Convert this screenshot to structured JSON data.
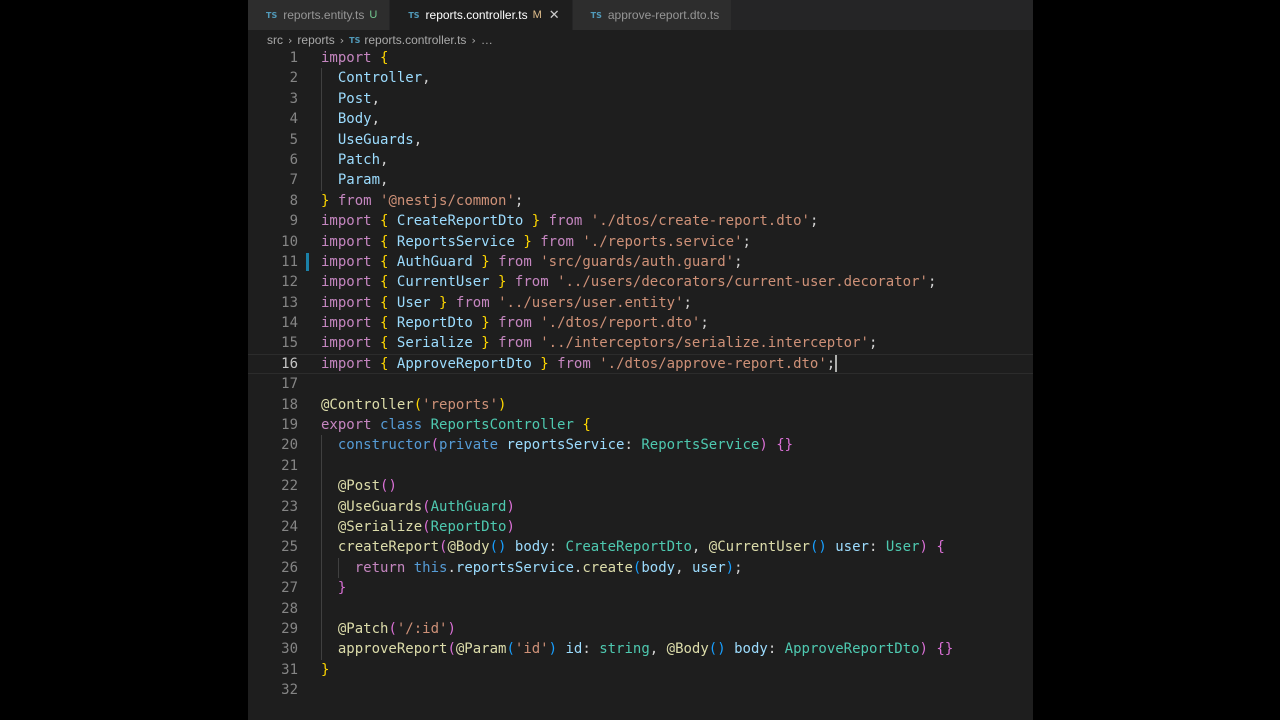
{
  "tabs": [
    {
      "icon": "TS",
      "label": "reports.entity.ts",
      "status": "U",
      "active": false
    },
    {
      "icon": "TS",
      "label": "reports.controller.ts",
      "status": "M",
      "active": true
    },
    {
      "icon": "TS",
      "label": "approve-report.dto.ts",
      "status": "",
      "active": false
    }
  ],
  "breadcrumb": {
    "folder1": "src",
    "folder2": "reports",
    "file": "reports.controller.ts",
    "more": "…"
  },
  "cursor_line": 16,
  "code_lines": [
    [
      [
        "k",
        "import"
      ],
      [
        "p",
        " "
      ],
      [
        "b1",
        "{"
      ]
    ],
    [
      [
        "p",
        "  "
      ],
      [
        "v",
        "Controller"
      ],
      [
        "p",
        ","
      ]
    ],
    [
      [
        "p",
        "  "
      ],
      [
        "v",
        "Post"
      ],
      [
        "p",
        ","
      ]
    ],
    [
      [
        "p",
        "  "
      ],
      [
        "v",
        "Body"
      ],
      [
        "p",
        ","
      ]
    ],
    [
      [
        "p",
        "  "
      ],
      [
        "v",
        "UseGuards"
      ],
      [
        "p",
        ","
      ]
    ],
    [
      [
        "p",
        "  "
      ],
      [
        "v",
        "Patch"
      ],
      [
        "p",
        ","
      ]
    ],
    [
      [
        "p",
        "  "
      ],
      [
        "v",
        "Param"
      ],
      [
        "p",
        ","
      ]
    ],
    [
      [
        "b1",
        "}"
      ],
      [
        "p",
        " "
      ],
      [
        "k",
        "from"
      ],
      [
        "p",
        " "
      ],
      [
        "s",
        "'@nestjs/common'"
      ],
      [
        "p",
        ";"
      ]
    ],
    [
      [
        "k",
        "import"
      ],
      [
        "p",
        " "
      ],
      [
        "b1",
        "{"
      ],
      [
        "p",
        " "
      ],
      [
        "v",
        "CreateReportDto"
      ],
      [
        "p",
        " "
      ],
      [
        "b1",
        "}"
      ],
      [
        "p",
        " "
      ],
      [
        "k",
        "from"
      ],
      [
        "p",
        " "
      ],
      [
        "s",
        "'./dtos/create-report.dto'"
      ],
      [
        "p",
        ";"
      ]
    ],
    [
      [
        "k",
        "import"
      ],
      [
        "p",
        " "
      ],
      [
        "b1",
        "{"
      ],
      [
        "p",
        " "
      ],
      [
        "v",
        "ReportsService"
      ],
      [
        "p",
        " "
      ],
      [
        "b1",
        "}"
      ],
      [
        "p",
        " "
      ],
      [
        "k",
        "from"
      ],
      [
        "p",
        " "
      ],
      [
        "s",
        "'./reports.service'"
      ],
      [
        "p",
        ";"
      ]
    ],
    [
      [
        "k",
        "import"
      ],
      [
        "p",
        " "
      ],
      [
        "b1",
        "{"
      ],
      [
        "p",
        " "
      ],
      [
        "v",
        "AuthGuard"
      ],
      [
        "p",
        " "
      ],
      [
        "b1",
        "}"
      ],
      [
        "p",
        " "
      ],
      [
        "k",
        "from"
      ],
      [
        "p",
        " "
      ],
      [
        "s",
        "'src/guards/auth.guard'"
      ],
      [
        "p",
        ";"
      ]
    ],
    [
      [
        "k",
        "import"
      ],
      [
        "p",
        " "
      ],
      [
        "b1",
        "{"
      ],
      [
        "p",
        " "
      ],
      [
        "v",
        "CurrentUser"
      ],
      [
        "p",
        " "
      ],
      [
        "b1",
        "}"
      ],
      [
        "p",
        " "
      ],
      [
        "k",
        "from"
      ],
      [
        "p",
        " "
      ],
      [
        "s",
        "'../users/decorators/current-user.decorator'"
      ],
      [
        "p",
        ";"
      ]
    ],
    [
      [
        "k",
        "import"
      ],
      [
        "p",
        " "
      ],
      [
        "b1",
        "{"
      ],
      [
        "p",
        " "
      ],
      [
        "v",
        "User"
      ],
      [
        "p",
        " "
      ],
      [
        "b1",
        "}"
      ],
      [
        "p",
        " "
      ],
      [
        "k",
        "from"
      ],
      [
        "p",
        " "
      ],
      [
        "s",
        "'../users/user.entity'"
      ],
      [
        "p",
        ";"
      ]
    ],
    [
      [
        "k",
        "import"
      ],
      [
        "p",
        " "
      ],
      [
        "b1",
        "{"
      ],
      [
        "p",
        " "
      ],
      [
        "v",
        "ReportDto"
      ],
      [
        "p",
        " "
      ],
      [
        "b1",
        "}"
      ],
      [
        "p",
        " "
      ],
      [
        "k",
        "from"
      ],
      [
        "p",
        " "
      ],
      [
        "s",
        "'./dtos/report.dto'"
      ],
      [
        "p",
        ";"
      ]
    ],
    [
      [
        "k",
        "import"
      ],
      [
        "p",
        " "
      ],
      [
        "b1",
        "{"
      ],
      [
        "p",
        " "
      ],
      [
        "v",
        "Serialize"
      ],
      [
        "p",
        " "
      ],
      [
        "b1",
        "}"
      ],
      [
        "p",
        " "
      ],
      [
        "k",
        "from"
      ],
      [
        "p",
        " "
      ],
      [
        "s",
        "'../interceptors/serialize.interceptor'"
      ],
      [
        "p",
        ";"
      ]
    ],
    [
      [
        "k",
        "import"
      ],
      [
        "p",
        " "
      ],
      [
        "b1",
        "{"
      ],
      [
        "p",
        " "
      ],
      [
        "v",
        "ApproveReportDto"
      ],
      [
        "p",
        " "
      ],
      [
        "b1",
        "}"
      ],
      [
        "p",
        " "
      ],
      [
        "k",
        "from"
      ],
      [
        "p",
        " "
      ],
      [
        "s",
        "'./dtos/approve-report.dto'"
      ],
      [
        "p",
        ";"
      ]
    ],
    [],
    [
      [
        "f",
        "@Controller"
      ],
      [
        "b1",
        "("
      ],
      [
        "s",
        "'reports'"
      ],
      [
        "b1",
        ")"
      ]
    ],
    [
      [
        "k",
        "export"
      ],
      [
        "p",
        " "
      ],
      [
        "kw",
        "class"
      ],
      [
        "p",
        " "
      ],
      [
        "t",
        "ReportsController"
      ],
      [
        "p",
        " "
      ],
      [
        "b1",
        "{"
      ]
    ],
    [
      [
        "p",
        "  "
      ],
      [
        "kw",
        "constructor"
      ],
      [
        "b2",
        "("
      ],
      [
        "kw",
        "private"
      ],
      [
        "p",
        " "
      ],
      [
        "v",
        "reportsService"
      ],
      [
        "p",
        ": "
      ],
      [
        "t",
        "ReportsService"
      ],
      [
        "b2",
        ")"
      ],
      [
        "p",
        " "
      ],
      [
        "b2",
        "{}"
      ]
    ],
    [],
    [
      [
        "p",
        "  "
      ],
      [
        "f",
        "@Post"
      ],
      [
        "b2",
        "()"
      ]
    ],
    [
      [
        "p",
        "  "
      ],
      [
        "f",
        "@UseGuards"
      ],
      [
        "b2",
        "("
      ],
      [
        "t",
        "AuthGuard"
      ],
      [
        "b2",
        ")"
      ]
    ],
    [
      [
        "p",
        "  "
      ],
      [
        "f",
        "@Serialize"
      ],
      [
        "b2",
        "("
      ],
      [
        "t",
        "ReportDto"
      ],
      [
        "b2",
        ")"
      ]
    ],
    [
      [
        "p",
        "  "
      ],
      [
        "f",
        "createReport"
      ],
      [
        "b2",
        "("
      ],
      [
        "f",
        "@Body"
      ],
      [
        "b3",
        "()"
      ],
      [
        "p",
        " "
      ],
      [
        "v",
        "body"
      ],
      [
        "p",
        ": "
      ],
      [
        "t",
        "CreateReportDto"
      ],
      [
        "p",
        ", "
      ],
      [
        "f",
        "@CurrentUser"
      ],
      [
        "b3",
        "()"
      ],
      [
        "p",
        " "
      ],
      [
        "v",
        "user"
      ],
      [
        "p",
        ": "
      ],
      [
        "t",
        "User"
      ],
      [
        "b2",
        ")"
      ],
      [
        "p",
        " "
      ],
      [
        "b2",
        "{"
      ]
    ],
    [
      [
        "p",
        "    "
      ],
      [
        "k",
        "return"
      ],
      [
        "p",
        " "
      ],
      [
        "kw",
        "this"
      ],
      [
        "p",
        "."
      ],
      [
        "v",
        "reportsService"
      ],
      [
        "p",
        "."
      ],
      [
        "f",
        "create"
      ],
      [
        "b3",
        "("
      ],
      [
        "v",
        "body"
      ],
      [
        "p",
        ", "
      ],
      [
        "v",
        "user"
      ],
      [
        "b3",
        ")"
      ],
      [
        "p",
        ";"
      ]
    ],
    [
      [
        "p",
        "  "
      ],
      [
        "b2",
        "}"
      ]
    ],
    [],
    [
      [
        "p",
        "  "
      ],
      [
        "f",
        "@Patch"
      ],
      [
        "b2",
        "("
      ],
      [
        "s",
        "'/:id'"
      ],
      [
        "b2",
        ")"
      ]
    ],
    [
      [
        "p",
        "  "
      ],
      [
        "f",
        "approveReport"
      ],
      [
        "b2",
        "("
      ],
      [
        "f",
        "@Param"
      ],
      [
        "b3",
        "("
      ],
      [
        "s",
        "'id'"
      ],
      [
        "b3",
        ")"
      ],
      [
        "p",
        " "
      ],
      [
        "v",
        "id"
      ],
      [
        "p",
        ": "
      ],
      [
        "t",
        "string"
      ],
      [
        "p",
        ", "
      ],
      [
        "f",
        "@Body"
      ],
      [
        "b3",
        "()"
      ],
      [
        "p",
        " "
      ],
      [
        "v",
        "body"
      ],
      [
        "p",
        ": "
      ],
      [
        "t",
        "ApproveReportDto"
      ],
      [
        "b2",
        ")"
      ],
      [
        "p",
        " "
      ],
      [
        "b2",
        "{}"
      ]
    ],
    [
      [
        "b1",
        "}"
      ]
    ],
    []
  ],
  "icons": {
    "ts": "typescript-file-icon",
    "close": "close-icon",
    "chevron": "chevron-right-icon"
  }
}
